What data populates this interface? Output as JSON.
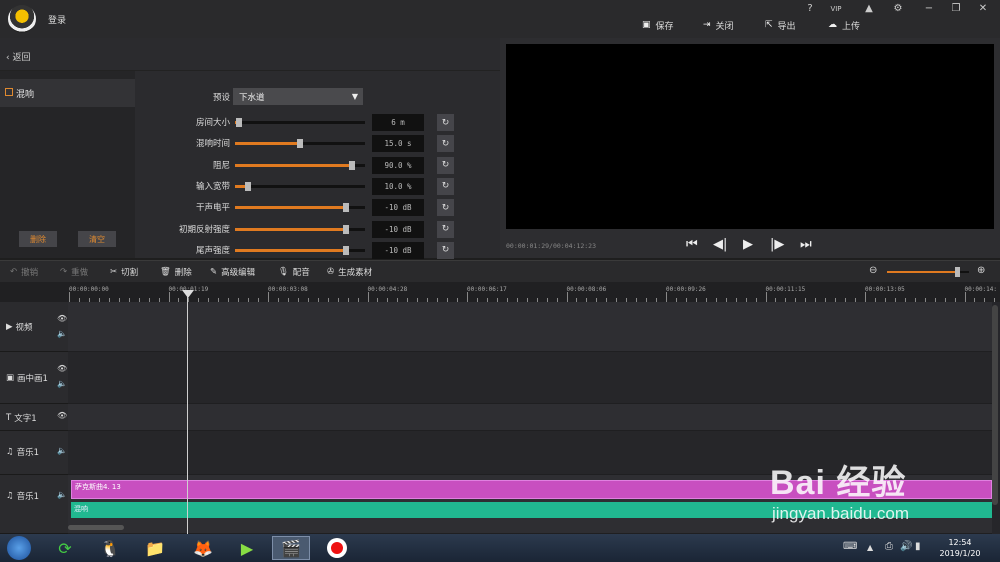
{
  "header": {
    "login": "登录",
    "save": "保存",
    "close": "关闭",
    "export": "导出",
    "upload": "上传",
    "help": "?",
    "vip": "VIP",
    "window_controls": [
      "−",
      "❐",
      "✕"
    ]
  },
  "leftpanel": {
    "back": "返回",
    "effect": "混响",
    "delete": "删除",
    "clear": "清空"
  },
  "params": {
    "preset_label": "预设",
    "preset_value": "下水道",
    "rows": [
      {
        "label": "房间大小",
        "value": "6 m",
        "level": 0.03
      },
      {
        "label": "混响时间",
        "value": "15.0 s",
        "level": 0.5
      },
      {
        "label": "阻尼",
        "value": "90.0 %",
        "level": 0.9
      },
      {
        "label": "输入宽带",
        "value": "10.0 %",
        "level": 0.1
      },
      {
        "label": "干声电平",
        "value": "-10 dB",
        "level": 0.85
      },
      {
        "label": "初期反射强度",
        "value": "-10 dB",
        "level": 0.85
      },
      {
        "label": "尾声强度",
        "value": "-10 dB",
        "level": 0.85
      }
    ]
  },
  "preview": {
    "timecode": "00:00:01:29/00:04:12:23"
  },
  "toolbar": {
    "undo": "撤销",
    "redo": "重做",
    "cut": "切割",
    "delete": "删除",
    "advanced": "高级编辑",
    "dub": "配音",
    "generate": "生成素材",
    "zoom_level": 0.85
  },
  "ruler": {
    "ticks": [
      "00:00:00:00",
      "00:00:01:19",
      "00:00:03:08",
      "00:00:04:28",
      "00:00:06:17",
      "00:00:08:06",
      "00:00:09:26",
      "00:00:11:15",
      "00:00:13:05",
      "00:00:14:"
    ]
  },
  "tracks": {
    "video": "视频",
    "pip": "画中画1",
    "text": "文字1",
    "music1": "音乐1",
    "music2": "音乐1"
  },
  "clips": {
    "music_clip": "萨克斯曲4. 13",
    "effect_clip": "混响"
  },
  "taskbar": {
    "time": "12:54",
    "date": "2019/1/20"
  },
  "watermark": {
    "brand": "Bai 经验",
    "url": "jingyan.baidu.com"
  },
  "colors": {
    "accent": "#e07a20",
    "clip_pink": "#c84fc0",
    "clip_green": "#20b890"
  }
}
